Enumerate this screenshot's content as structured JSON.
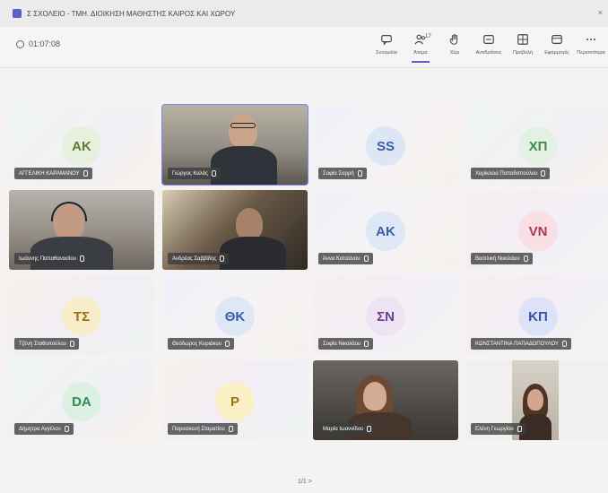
{
  "window": {
    "title": "Σ ΣΧΟΛΕΙΟ - ΤΜΗ. ΔΙΟΙΚΗΣΗ ΜΑΘΗΣΤΗΣ ΚΑΙΡΟΣ ΚΑΙ ΧΩΡΟΥ"
  },
  "toolbar": {
    "timer": "01:07:08",
    "tools": [
      {
        "label": "Συνομιλία",
        "icon": "chat-icon"
      },
      {
        "label": "Άτομα",
        "icon": "people-icon",
        "count": "17",
        "active": true
      },
      {
        "label": "Χέρι",
        "icon": "raise-hand-icon"
      },
      {
        "label": "Αντιδράσεις",
        "icon": "reactions-icon"
      },
      {
        "label": "Προβολή",
        "icon": "view-icon"
      },
      {
        "label": "Εφαρμογές",
        "icon": "apps-icon"
      },
      {
        "label": "Περισσότερα",
        "icon": "more-icon"
      }
    ]
  },
  "participants": [
    {
      "initials": "ΑΚ",
      "name": "ΑΓΓΕΛΙΚΗ ΚΑΡΑΜΑΝΟΥ",
      "avatar_bg": "#e6f0dd",
      "avatar_fg": "#5f7d36",
      "tone": "t-green"
    },
    {
      "initials": "",
      "name": "Γιώργος Καλός",
      "video": true,
      "selected": true,
      "scene": "man-glasses"
    },
    {
      "initials": "SS",
      "name": "Σοφία Σαρρή",
      "avatar_bg": "#dce6f5",
      "avatar_fg": "#3b5ea8",
      "tone": "t-blue"
    },
    {
      "initials": "ΧΠ",
      "name": "Χαρίκλεια Παπαδοπούλου",
      "avatar_bg": "#e3f1e4",
      "avatar_fg": "#3f8a4b",
      "tone": "t-green"
    },
    {
      "initials": "",
      "name": "Ιωάννης Παπαθανασίου",
      "video": true,
      "scene": "man-headset"
    },
    {
      "initials": "",
      "name": "Ανδρέας Σαββίδης",
      "video": true,
      "scene": "man-dark"
    },
    {
      "initials": "ΑΚ",
      "name": "Άννα Κατσάνου",
      "avatar_bg": "#dde7f6",
      "avatar_fg": "#3a5ea6",
      "tone": "t-blue"
    },
    {
      "initials": "VN",
      "name": "Βασιλική Νικολάου",
      "avatar_bg": "#f7dfe4",
      "avatar_fg": "#b1364f",
      "tone": "t-pink"
    },
    {
      "initials": "ΤΣ",
      "name": "Τζένη Σταθοπούλου",
      "avatar_bg": "#f8eccb",
      "avatar_fg": "#9a6d12",
      "tone": ""
    },
    {
      "initials": "ΘΚ",
      "name": "Θεόδωρος Κυριάκου",
      "avatar_bg": "#dde7f6",
      "avatar_fg": "#3a5ea6",
      "tone": "t-blue"
    },
    {
      "initials": "ΣΝ",
      "name": "Σοφία Νικολάου",
      "avatar_bg": "#ece3f3",
      "avatar_fg": "#6b3c8f",
      "tone": "t-pink"
    },
    {
      "initials": "ΚΠ",
      "name": "ΚΩΝΣΤΑΝΤΙΝΑ ΠΑΠΑΔΟΠΟΥΛΟΥ",
      "avatar_bg": "#dde3f7",
      "avatar_fg": "#3a4fa6",
      "tone": "t-pink"
    },
    {
      "initials": "DA",
      "name": "Δήμητρα Αγγέλου",
      "avatar_bg": "#dcf0e3",
      "avatar_fg": "#2f8a55",
      "tone": "t-green"
    },
    {
      "initials": "P",
      "name": "Παρασκευή Σταματίου",
      "avatar_bg": "#fbefc6",
      "avatar_fg": "#9a7410",
      "tone": ""
    },
    {
      "initials": "",
      "name": "Μαρία Ιωαννίδου",
      "video": true,
      "scene": "woman-dark"
    },
    {
      "initials": "",
      "name": "Ελένη Γεωργίου",
      "video": true,
      "scene": "woman-small"
    }
  ],
  "pager": {
    "text": "1/1 >"
  }
}
